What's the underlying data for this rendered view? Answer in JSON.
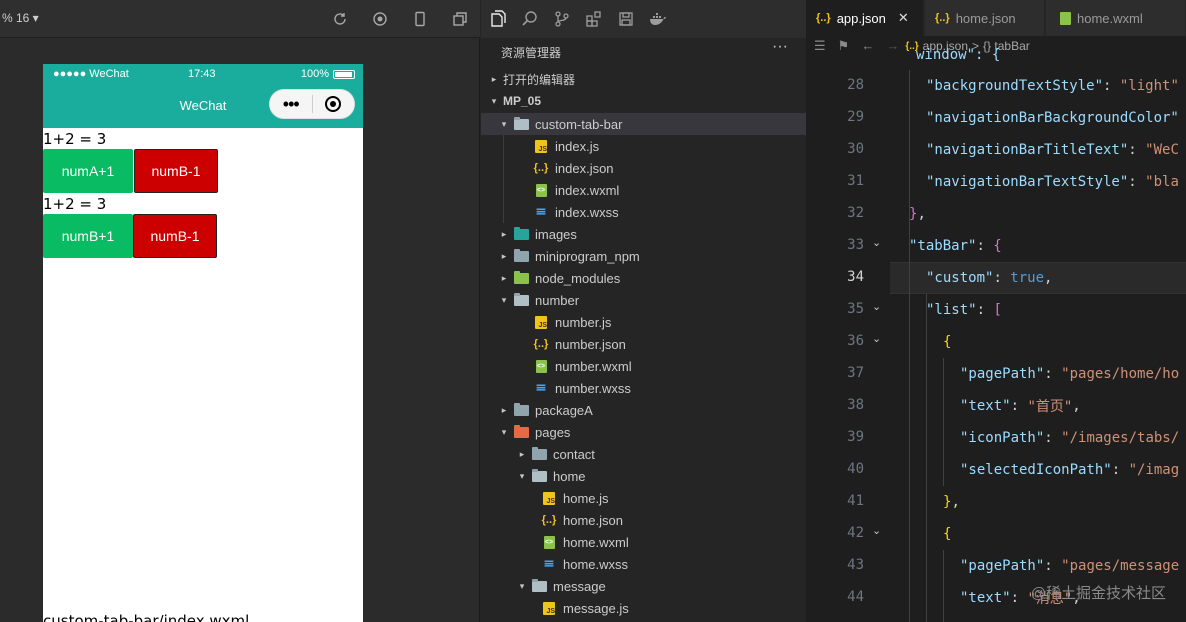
{
  "simulator": {
    "zoom_label": "% 16 ▾",
    "status": {
      "carrier": "●●●●● WeChat",
      "time": "17:43",
      "battery": "100%"
    },
    "nav_title": "WeChat",
    "page": {
      "sum1": "1+2 = 3",
      "buttons1": [
        "numA+1",
        "numB-1"
      ],
      "sum2": "1+2 = 3",
      "buttons2": [
        "numB+1",
        "numB-1"
      ],
      "bottom_text": "custom-tab-bar/index.wxml"
    }
  },
  "explorer": {
    "title": "资源管理器",
    "more": "···",
    "open_editors": "打开的编辑器",
    "project": "MP_05",
    "tree": [
      {
        "label": "custom-tab-bar",
        "type": "folder-open",
        "indent": 1,
        "caret": "▾",
        "selected": true
      },
      {
        "label": "index.js",
        "type": "js",
        "indent": 2
      },
      {
        "label": "index.json",
        "type": "json",
        "indent": 2
      },
      {
        "label": "index.wxml",
        "type": "wxml",
        "indent": 2
      },
      {
        "label": "index.wxss",
        "type": "wxss",
        "indent": 2
      },
      {
        "label": "images",
        "type": "folder-teal",
        "indent": 1,
        "caret": "▸"
      },
      {
        "label": "miniprogram_npm",
        "type": "folder",
        "indent": 1,
        "caret": "▸"
      },
      {
        "label": "node_modules",
        "type": "folder-green",
        "indent": 1,
        "caret": "▸"
      },
      {
        "label": "number",
        "type": "folder-open",
        "indent": 1,
        "caret": "▾"
      },
      {
        "label": "number.js",
        "type": "js",
        "indent": 2
      },
      {
        "label": "number.json",
        "type": "json",
        "indent": 2
      },
      {
        "label": "number.wxml",
        "type": "wxml",
        "indent": 2
      },
      {
        "label": "number.wxss",
        "type": "wxss",
        "indent": 2
      },
      {
        "label": "packageA",
        "type": "folder",
        "indent": 1,
        "caret": "▸"
      },
      {
        "label": "pages",
        "type": "folder-orange",
        "indent": 1,
        "caret": "▾"
      },
      {
        "label": "contact",
        "type": "folder",
        "indent": 2,
        "caret": "▸"
      },
      {
        "label": "home",
        "type": "folder-open",
        "indent": 2,
        "caret": "▾"
      },
      {
        "label": "home.js",
        "type": "js",
        "indent": 3
      },
      {
        "label": "home.json",
        "type": "json",
        "indent": 3
      },
      {
        "label": "home.wxml",
        "type": "wxml",
        "indent": 3
      },
      {
        "label": "home.wxss",
        "type": "wxss",
        "indent": 3
      },
      {
        "label": "message",
        "type": "folder-open",
        "indent": 2,
        "caret": "▾"
      },
      {
        "label": "message.js",
        "type": "js",
        "indent": 3
      }
    ]
  },
  "editor": {
    "tabs": [
      {
        "label": "app.json",
        "icon": "{..}",
        "active": true,
        "close": "✕"
      },
      {
        "label": "home.json",
        "icon": "{..}",
        "active": false
      },
      {
        "label": "home.wxml",
        "icon": "wxml",
        "active": false
      }
    ],
    "breadcrumb": {
      "file": "app.json",
      "sep": ">",
      "symbol": "{} tabBar"
    },
    "current_line": 34,
    "lines": [
      {
        "n": 28,
        "text_key": "\"backgroundTextStyle\"",
        "text_val": ": \"light\""
      },
      {
        "n": 29,
        "text_key": "\"navigationBarBackgroundColor\"",
        "text_val": ""
      },
      {
        "n": 30,
        "text_key": "\"navigationBarTitleText\"",
        "text_val": ": \"WeC"
      },
      {
        "n": 31,
        "text_key": "\"navigationBarTextStyle\"",
        "text_val": ": \"bla"
      },
      {
        "n": 32,
        "text_key": "",
        "text_val": "},"
      },
      {
        "n": 33,
        "text_key": "\"tabBar\"",
        "text_val": ": {"
      },
      {
        "n": 34,
        "text_key": "\"custom\"",
        "text_val": ": true,"
      },
      {
        "n": 35,
        "text_key": "\"list\"",
        "text_val": ": ["
      },
      {
        "n": 36,
        "text_key": "",
        "text_val": "{"
      },
      {
        "n": 37,
        "text_key": "\"pagePath\"",
        "text_val": ": \"pages/home/ho"
      },
      {
        "n": 38,
        "text_key": "\"text\"",
        "text_val": ": \"首页\","
      },
      {
        "n": 39,
        "text_key": "\"iconPath\"",
        "text_val": ": \"/images/tabs/"
      },
      {
        "n": 40,
        "text_key": "\"selectedIconPath\"",
        "text_val": ": \"/imag"
      },
      {
        "n": 41,
        "text_key": "",
        "text_val": "},"
      },
      {
        "n": 42,
        "text_key": "",
        "text_val": "{"
      },
      {
        "n": 43,
        "text_key": "\"pagePath\"",
        "text_val": ": \"pages/message"
      },
      {
        "n": 44,
        "text_key": "\"text\"",
        "text_val": ": \"消息\","
      }
    ],
    "top_partial": "window\": {"
  },
  "watermark": "@稀土掘金技术社区",
  "colors": {
    "nav_teal": "#1aad9e",
    "btn_green": "#09bb62",
    "btn_red": "#cc0000",
    "editor_bg": "#1e1e1e"
  }
}
